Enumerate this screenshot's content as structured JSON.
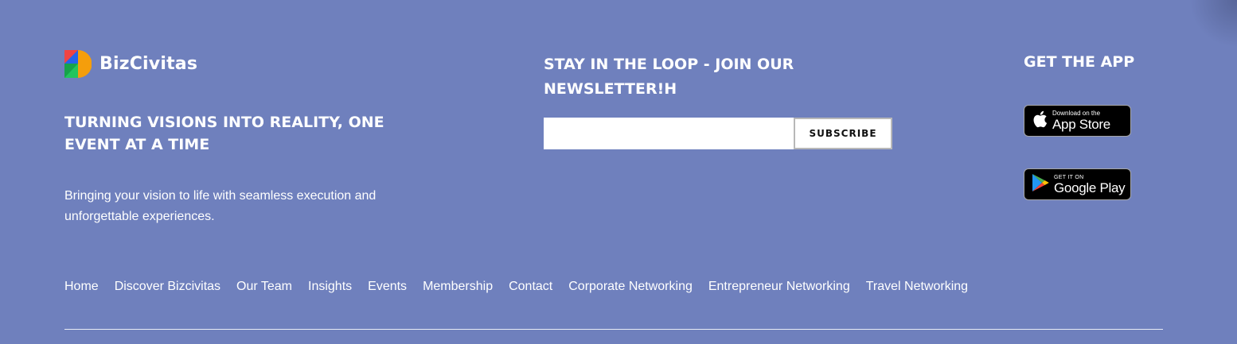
{
  "brand": {
    "name": "BizCivitas",
    "logo_colors": [
      "#1d4ed8",
      "#ef4444",
      "#22c55e",
      "#f59e0b"
    ]
  },
  "tagline": "TURNING VISIONS INTO REALITY, ONE EVENT AT A TIME",
  "description": "Bringing your vision to life with seamless execution and unforgettable experiences.",
  "newsletter": {
    "title": "STAY IN THE LOOP - JOIN OUR NEWSLETTER!H",
    "email_value": "",
    "email_placeholder": "",
    "subscribe_label": "SUBSCRIBE"
  },
  "app": {
    "title": "GET THE APP",
    "apple": {
      "small": "Download on the",
      "big": "App Store",
      "icon": "apple-icon"
    },
    "google": {
      "small": "GET IT ON",
      "big": "Google Play",
      "icon": "google-play-icon"
    }
  },
  "nav": {
    "items": [
      "Home",
      "Discover Bizcivitas",
      "Our Team",
      "Insights",
      "Events",
      "Membership",
      "Contact",
      "Corporate Networking",
      "Entrepreneur Networking",
      "Travel Networking"
    ]
  },
  "colors": {
    "background": "#6f80bd",
    "text": "#ffffff"
  }
}
